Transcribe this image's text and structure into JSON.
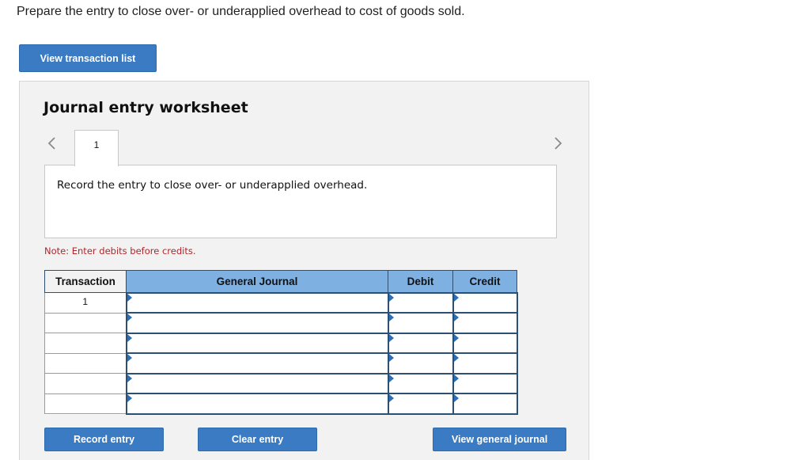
{
  "instruction": "Prepare the entry to close over- or underapplied overhead to cost of goods sold.",
  "view_transaction_list_label": "View transaction list",
  "worksheet": {
    "title": "Journal entry worksheet",
    "tabs": [
      "1"
    ],
    "description": "Record the entry to close over- or underapplied overhead.",
    "note": "Note: Enter debits before credits.",
    "table": {
      "headers": [
        "Transaction",
        "General Journal",
        "Debit",
        "Credit"
      ],
      "rows": [
        {
          "transaction": "1",
          "account": "",
          "debit": "",
          "credit": ""
        },
        {
          "transaction": "",
          "account": "",
          "debit": "",
          "credit": ""
        },
        {
          "transaction": "",
          "account": "",
          "debit": "",
          "credit": ""
        },
        {
          "transaction": "",
          "account": "",
          "debit": "",
          "credit": ""
        },
        {
          "transaction": "",
          "account": "",
          "debit": "",
          "credit": ""
        },
        {
          "transaction": "",
          "account": "",
          "debit": "",
          "credit": ""
        }
      ]
    },
    "buttons": {
      "record_entry": "Record entry",
      "clear_entry": "Clear entry",
      "view_general_journal": "View general journal"
    }
  },
  "icons": {
    "prev": "chevron-left-icon",
    "next": "chevron-right-icon"
  },
  "colors": {
    "button_blue": "#3a7bc4",
    "header_blue": "#7fb0e2",
    "note_red": "#b0262a",
    "worksheet_bg": "#f2f2f2"
  }
}
